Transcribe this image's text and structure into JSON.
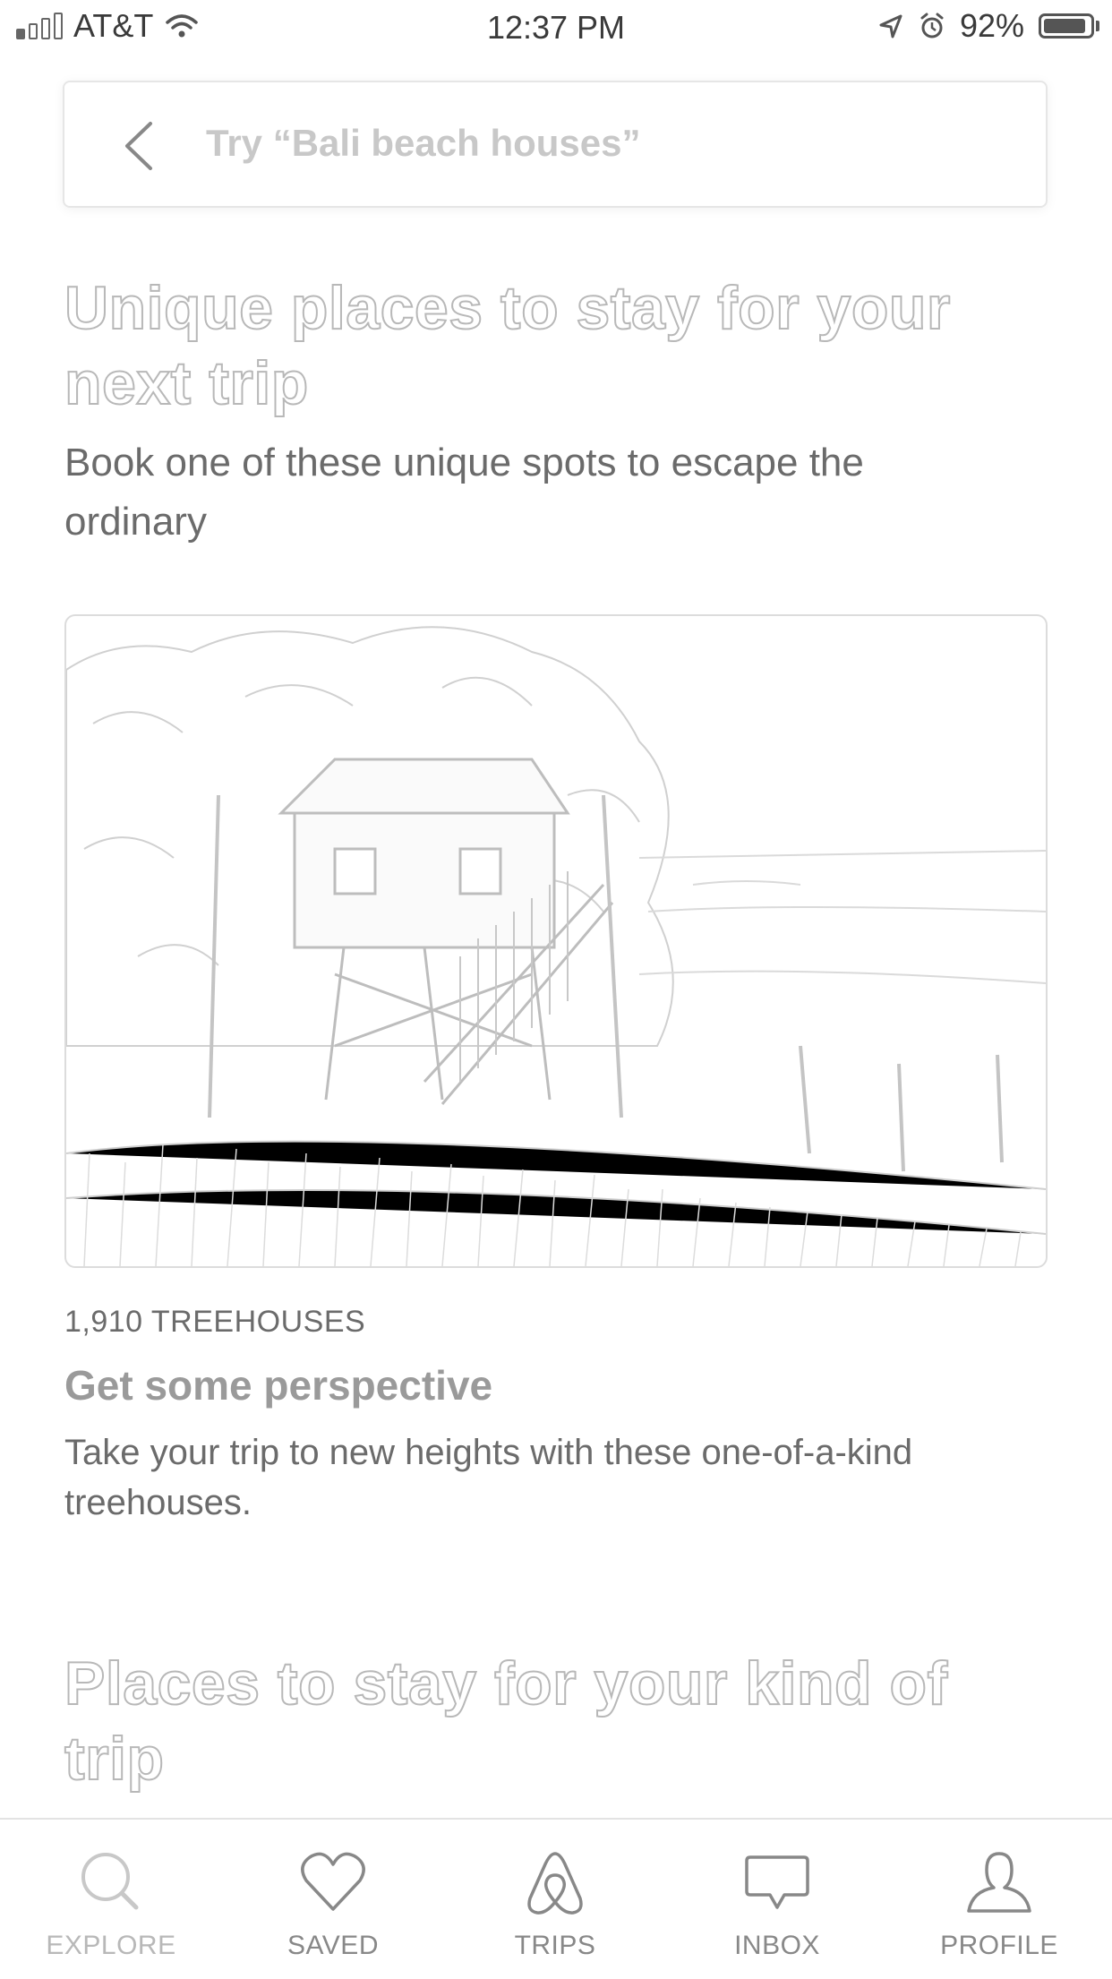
{
  "status_bar": {
    "carrier": "AT&T",
    "time": "12:37 PM",
    "battery": "92%",
    "battery_level": 0.92
  },
  "search": {
    "placeholder": "Try “Bali beach houses”"
  },
  "section1": {
    "title": "Unique places to stay for your next trip",
    "subtitle": "Book one of these unique spots to escape the ordinary"
  },
  "card": {
    "kicker": "1,910 TREEHOUSES",
    "title": "Get some perspective",
    "description": "Take your trip to new heights with these one-of-a-kind treehouses."
  },
  "section2": {
    "title": "Places to stay for your kind of trip"
  },
  "tabs": [
    {
      "label": "EXPLORE",
      "icon": "search-icon"
    },
    {
      "label": "SAVED",
      "icon": "heart-icon"
    },
    {
      "label": "TRIPS",
      "icon": "airbnb-logo-icon"
    },
    {
      "label": "INBOX",
      "icon": "message-icon"
    },
    {
      "label": "PROFILE",
      "icon": "user-icon"
    }
  ]
}
